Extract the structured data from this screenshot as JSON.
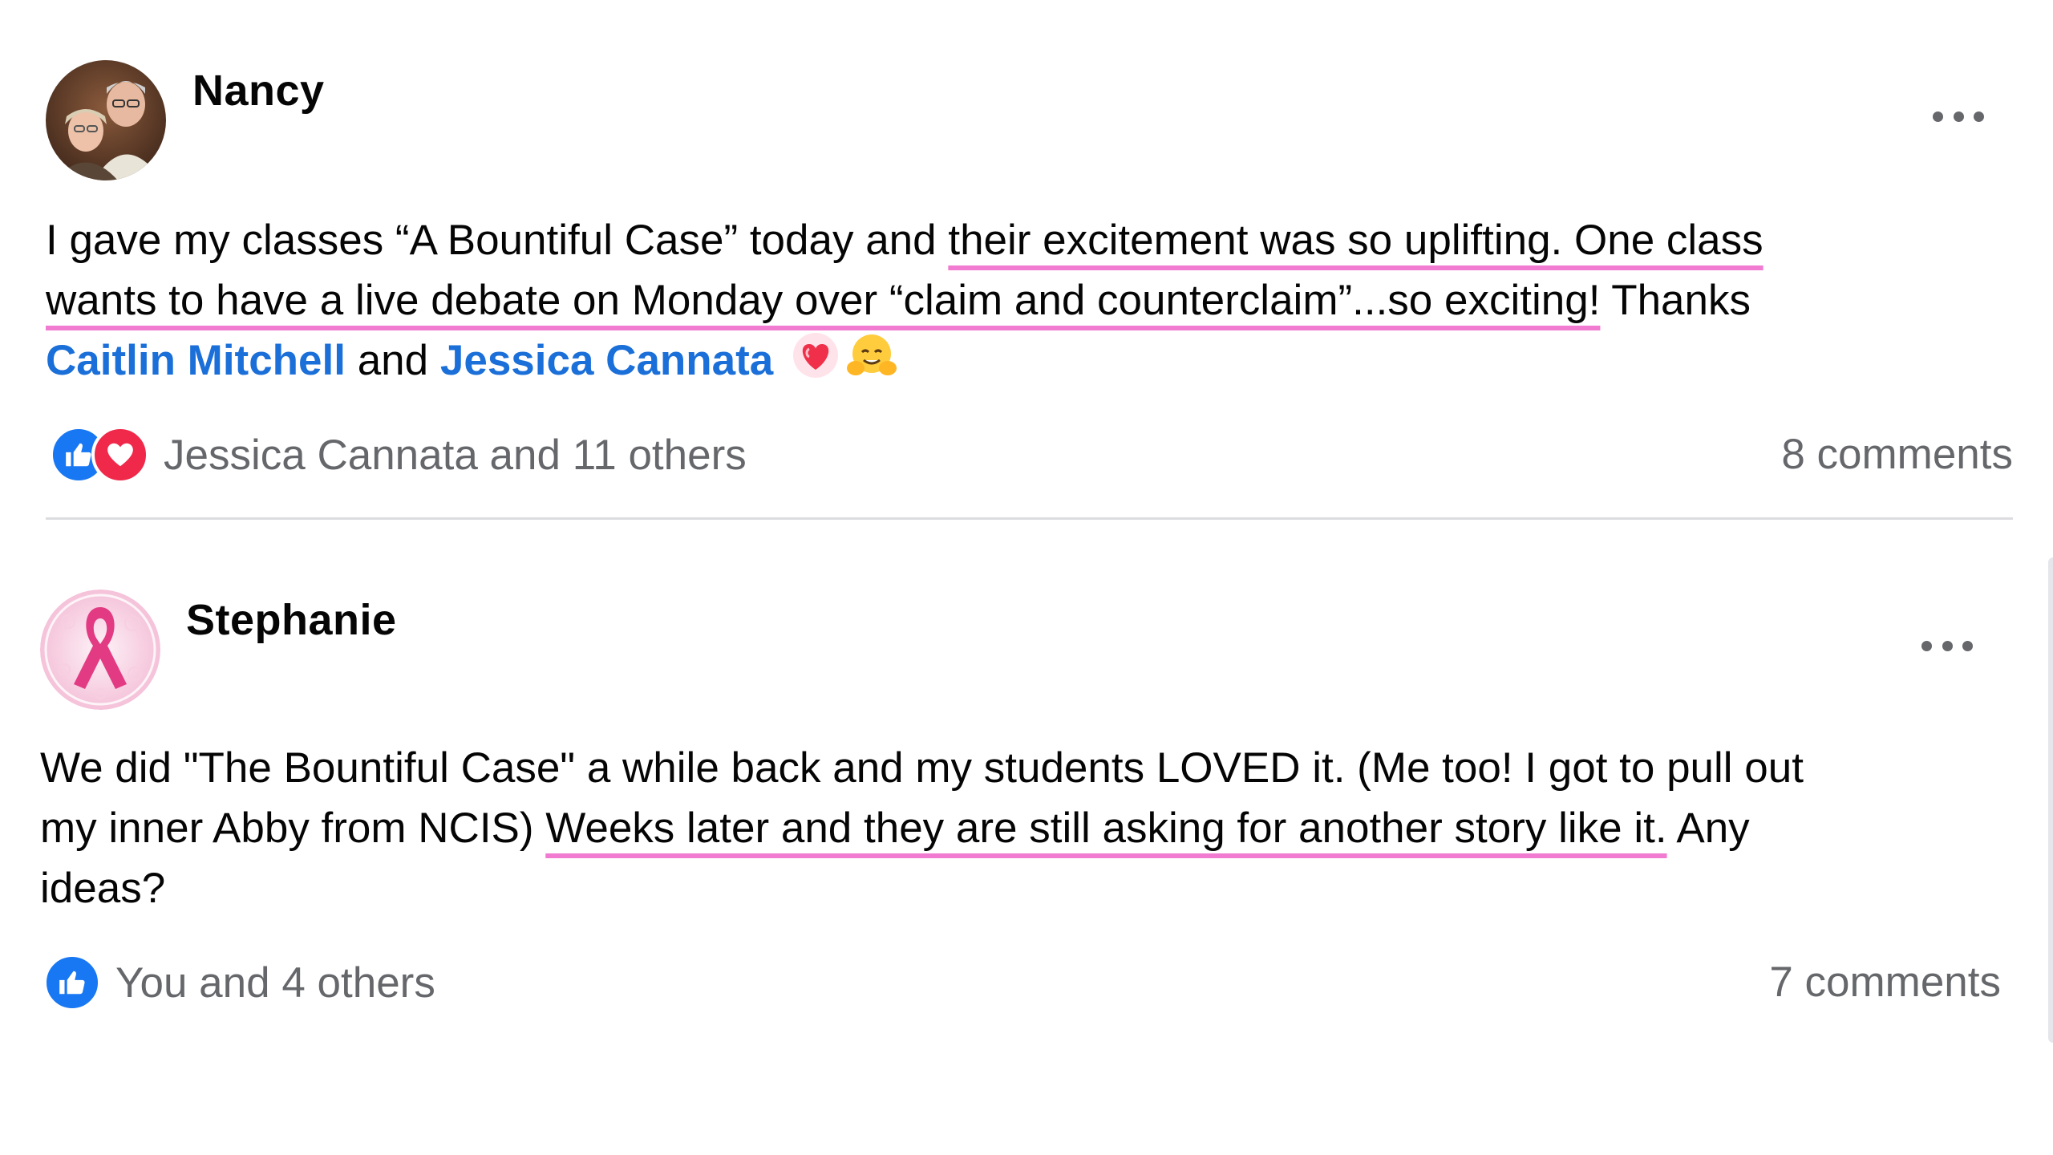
{
  "posts": [
    {
      "author": "Nancy",
      "text": {
        "line1_a": "I gave my classes “A Bountiful Case” today and ",
        "line1_b": "their excitement was so uplifting. One class",
        "line2_a": "wants to have a live debate on Monday over “claim and counterclaim”...so exciting!",
        "line2_b": "  Thanks",
        "mention1": "Caitlin Mitchell",
        "connector": " and ",
        "mention2": "Jessica Cannata"
      },
      "reactions_label": "Jessica Cannata and 11 others",
      "comments_label": "8 comments"
    },
    {
      "author": "Stephanie",
      "text": {
        "line1": "We did \"The Bountiful Case\" a while back and my students LOVED it. (Me too!  I got to pull out",
        "line2_a": "my inner Abby from NCIS) ",
        "line2_b": "Weeks later and they are still asking for another story like it.",
        "line2_c": " Any",
        "line3": "ideas?"
      },
      "reactions_label": "You and 4 others",
      "comments_label": "7 comments"
    }
  ],
  "colors": {
    "highlight": "#f07bd0",
    "mention": "#1b6fd8",
    "like": "#1877f2",
    "love": "#f02849",
    "muted": "#65676b"
  },
  "icons": {
    "like": "thumbs-up-icon",
    "love": "heart-icon",
    "more": "more-options-icon",
    "emoji1": "sparkling-heart-emoji",
    "emoji2": "hugging-face-emoji"
  }
}
